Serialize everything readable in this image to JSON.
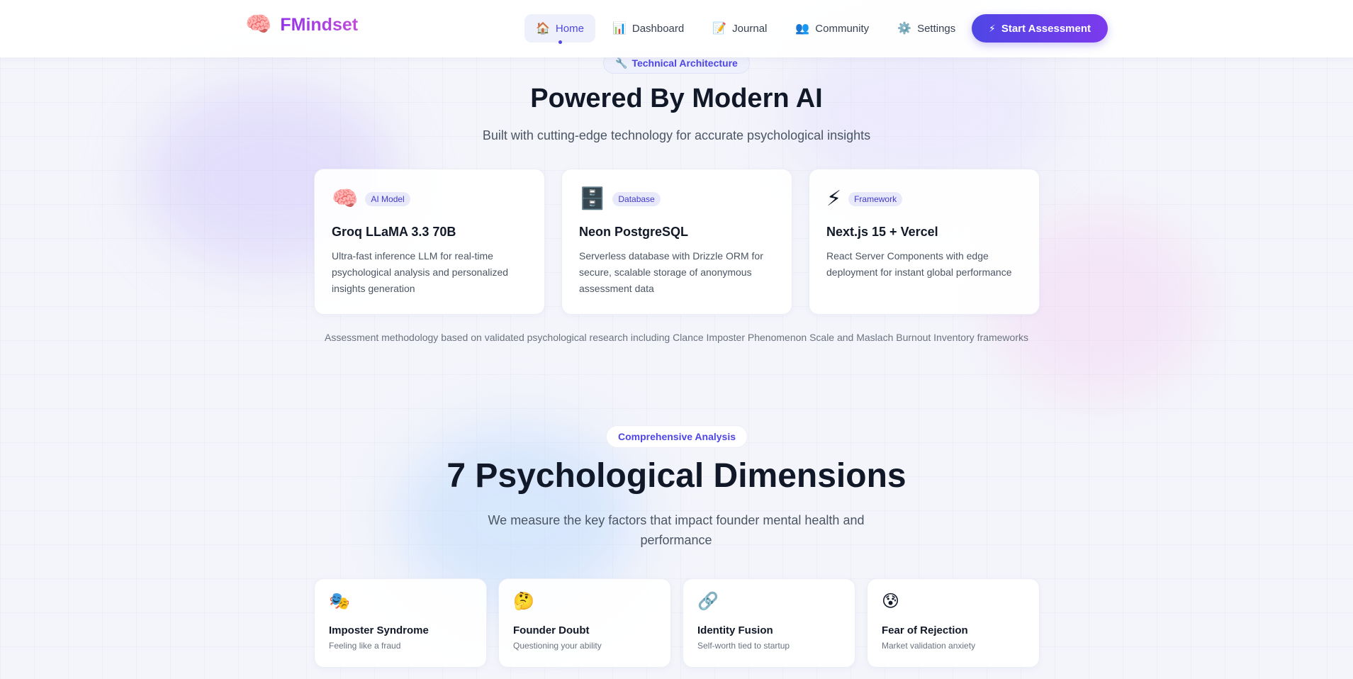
{
  "nav": {
    "brand_icon": "🧠",
    "brand_name": "FMindset",
    "links": [
      {
        "icon": "🏠",
        "label": "Home"
      },
      {
        "icon": "📊",
        "label": "Dashboard"
      },
      {
        "icon": "📝",
        "label": "Journal"
      },
      {
        "icon": "👥",
        "label": "Community"
      },
      {
        "icon": "⚙️",
        "label": "Settings"
      }
    ],
    "cta_icon": "⚡",
    "cta_label": "Start Assessment"
  },
  "tech": {
    "pill_icon": "🔧",
    "pill_label": "Technical Architecture",
    "title": "Powered By Modern AI",
    "subtitle": "Built with cutting-edge technology for accurate psychological insights",
    "cards": [
      {
        "icon": "🧠",
        "badge": "AI Model",
        "title": "Groq LLaMA 3.3 70B",
        "desc": "Ultra-fast inference LLM for real-time psychological analysis and personalized insights generation"
      },
      {
        "icon": "🗄️",
        "badge": "Database",
        "title": "Neon PostgreSQL",
        "desc": "Serverless database with Drizzle ORM for secure, scalable storage of anonymous assessment data"
      },
      {
        "icon": "⚡",
        "badge": "Framework",
        "title": "Next.js 15 + Vercel",
        "desc": "React Server Components with edge deployment for instant global performance"
      }
    ],
    "note": "Assessment methodology based on validated psychological research including Clance Imposter Phenomenon Scale and Maslach Burnout Inventory frameworks"
  },
  "dimensions": {
    "pill_label": "Comprehensive Analysis",
    "title": "7 Psychological Dimensions",
    "subtitle": "We measure the key factors that impact founder mental health and performance",
    "cards": [
      {
        "icon": "🎭",
        "title": "Imposter Syndrome",
        "desc": "Feeling like a fraud"
      },
      {
        "icon": "🤔",
        "title": "Founder Doubt",
        "desc": "Questioning your ability"
      },
      {
        "icon": "🔗",
        "title": "Identity Fusion",
        "desc": "Self-worth tied to startup"
      },
      {
        "icon": "😰",
        "title": "Fear of Rejection",
        "desc": "Market validation anxiety"
      }
    ]
  }
}
